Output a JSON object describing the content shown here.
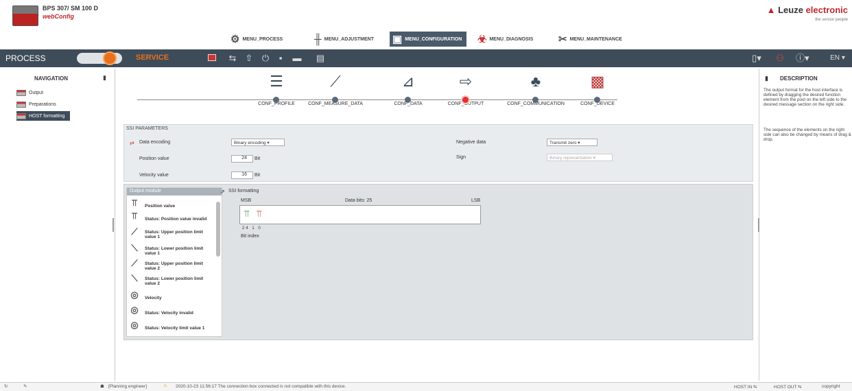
{
  "header": {
    "device_name": "BPS 307/ SM 100 D",
    "app_name": "webConfig",
    "brand_prefix": "Leuze",
    "brand_suffix": "electronic",
    "tagline": "the sensor people"
  },
  "menu_tabs": [
    {
      "label": "MENU_PROCESS",
      "icon": "gears-icon"
    },
    {
      "label": "MENU_ADJUSTMENT",
      "icon": "sliders-icon"
    },
    {
      "label": "MENU_CONFIGURATION",
      "icon": "clipboard-icon",
      "active": true
    },
    {
      "label": "MENU_DIAGNOSIS",
      "icon": "biohazard-icon"
    },
    {
      "label": "MENU_MAINTENANCE",
      "icon": "wrench-icon"
    }
  ],
  "toolbar": {
    "mode_process": "PROCESS",
    "mode_service": "SERVICE",
    "language": "EN"
  },
  "navigation": {
    "title": "NAVIGATION",
    "items": [
      "Output",
      "Preparations",
      "HOST formatting"
    ],
    "selected": "HOST formatting"
  },
  "workflow": {
    "steps": [
      "CONF_PROFILE",
      "CONF_MEASURE_DATA",
      "CONF_DATA",
      "CONF_OUTPUT",
      "CONF_COMMUNICATION",
      "CONF_DEVICE"
    ],
    "active": "CONF_OUTPUT"
  },
  "ssi": {
    "title": "SSI PARAMETERS",
    "data_encoding_label": "Data encoding",
    "data_encoding_value": "Binary encoding",
    "position_label": "Position value",
    "position_value": "24",
    "velocity_label": "Velocity value",
    "velocity_value": "16",
    "unit": "Bit",
    "negative_label": "Negative data",
    "negative_value": "Transmit zero",
    "sign_label": "Sign",
    "sign_value": "Binary representation"
  },
  "output_module": {
    "title": "Output module",
    "items": [
      "Position value",
      "Status: Position value invalid",
      "Status: Upper position limit value 1",
      "Status: Lower position limit value 1",
      "Status: Upper position limit value 2",
      "Status: Lower position limit value 2",
      "Velocity",
      "Status: Velocity invalid",
      "Status: Velocity limit value 1"
    ]
  },
  "ssi_formatting": {
    "title": "SSI formatting",
    "msb": "MSB",
    "data_bits": "Data bits: 25",
    "lsb": "LSB",
    "bit_nums": "24 1 0",
    "bit_index": "Bit index"
  },
  "description": {
    "title": "DESCRIPTION",
    "p1": "The output format for the host interface is defined by dragging the desired function element from the pool on the left side to the desired message section on the right side.",
    "p2": "The sequence of the elements on the right side can also be changed by means of drag & drop."
  },
  "statusbar": {
    "role": "[Planning engineer]",
    "message": "2020-10-23 11:56:17 The connection box connected is not compatible with this device.",
    "host_in": "HOST IN",
    "host_out": "HOST OUT",
    "copyright": "copyright"
  }
}
